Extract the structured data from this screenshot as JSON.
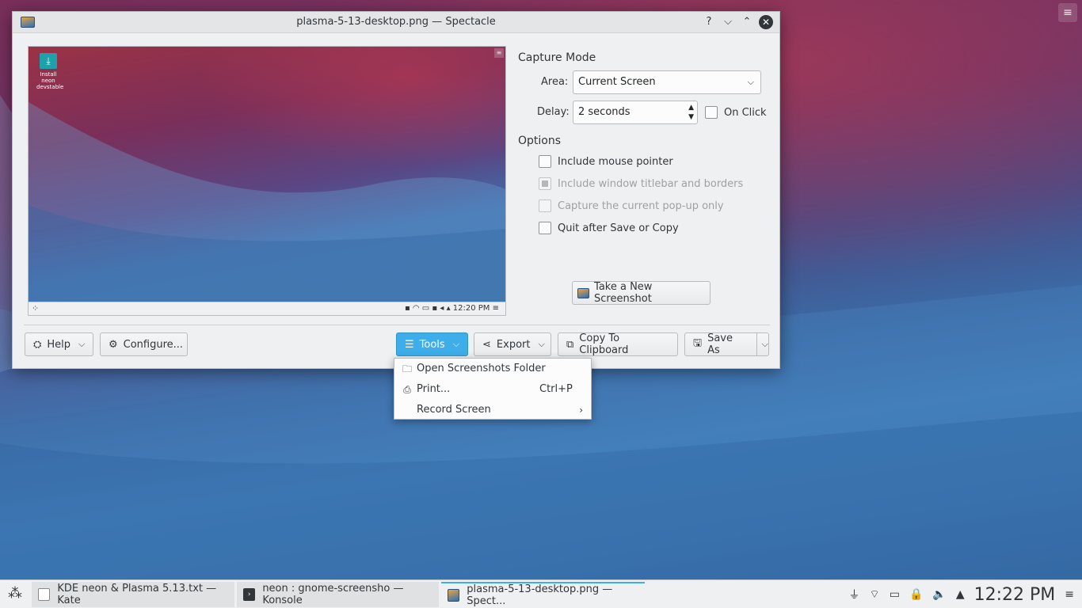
{
  "window": {
    "title": "plasma-5-13-desktop.png — Spectacle",
    "buttons": {
      "help": "?",
      "minimize": "⌵",
      "maximize": "⌃",
      "close": "✕"
    }
  },
  "preview": {
    "desktop_icon_label": "Install neon devstable",
    "panel_time": "12:20 PM"
  },
  "capture_mode": {
    "heading": "Capture Mode",
    "area_label": "Area:",
    "area_value": "Current Screen",
    "delay_label": "Delay:",
    "delay_value": "2 seconds",
    "on_click_label": "On Click",
    "on_click_checked": false
  },
  "options": {
    "heading": "Options",
    "items": [
      {
        "label": "Include mouse pointer",
        "checked": false,
        "enabled": true
      },
      {
        "label": "Include window titlebar and borders",
        "checked": "partial",
        "enabled": false
      },
      {
        "label": "Capture the current pop-up only",
        "checked": false,
        "enabled": false
      },
      {
        "label": "Quit after Save or Copy",
        "checked": false,
        "enabled": true
      }
    ]
  },
  "take_screenshot_label": "Take a New Screenshot",
  "bottom_bar": {
    "help": "Help",
    "configure": "Configure...",
    "tools": "Tools",
    "export": "Export",
    "copy": "Copy To Clipboard",
    "save_as": "Save As"
  },
  "tools_menu": {
    "items": [
      {
        "label": "Open Screenshots Folder",
        "shortcut": "",
        "icon": "folder-icon"
      },
      {
        "label": "Print...",
        "shortcut": "Ctrl+P",
        "icon": "printer-icon"
      },
      {
        "label": "Record Screen",
        "shortcut": "",
        "icon": "",
        "submenu": true
      }
    ]
  },
  "taskbar": {
    "tasks": [
      {
        "label": "KDE neon & Plasma 5.13.txt  — Kate",
        "icon": "kate-icon"
      },
      {
        "label": "neon : gnome-screensho — Konsole",
        "icon": "konsole-icon"
      },
      {
        "label": "plasma-5-13-desktop.png — Spect...",
        "icon": "spectacle-icon",
        "active": true
      }
    ],
    "clock": "12:22 PM"
  },
  "colors": {
    "accent": "#3daee9",
    "window_bg": "#eff0f1",
    "text": "#31363b"
  }
}
